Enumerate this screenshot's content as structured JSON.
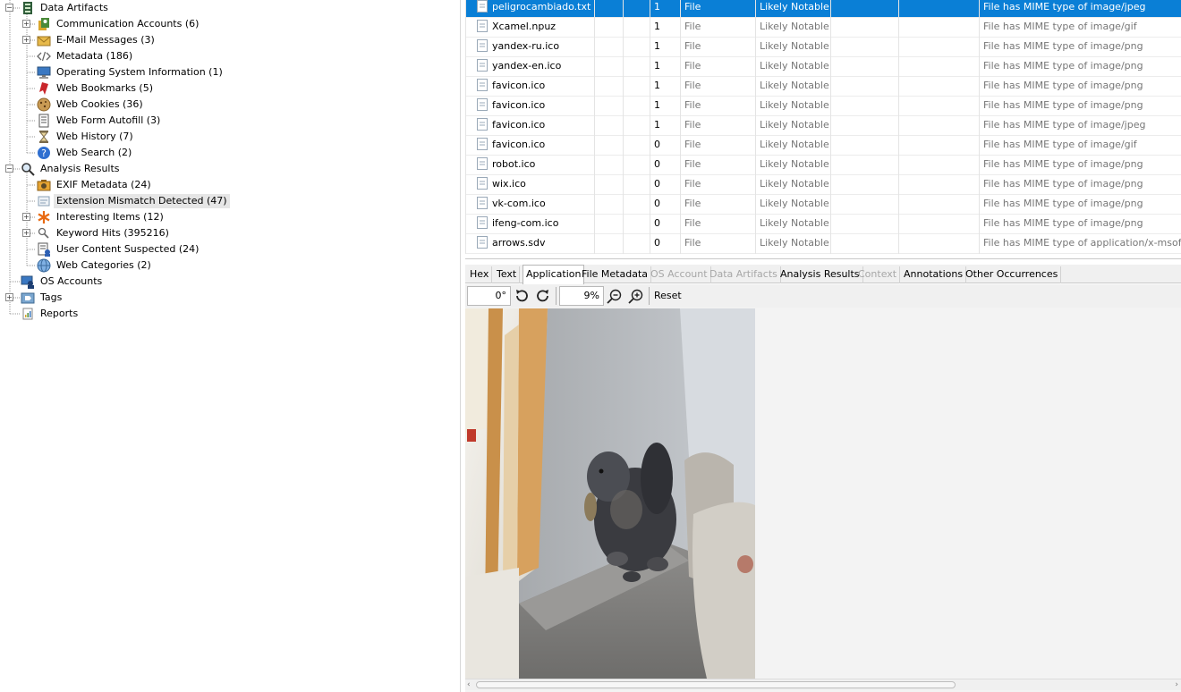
{
  "tree": {
    "data_artifacts": "Data Artifacts",
    "communication_accounts": "Communication Accounts (6)",
    "email_messages": "E-Mail Messages (3)",
    "metadata": "Metadata (186)",
    "os_info": "Operating System Information (1)",
    "web_bookmarks": "Web Bookmarks (5)",
    "web_cookies": "Web Cookies (36)",
    "web_form_autofill": "Web Form Autofill (3)",
    "web_history": "Web History (7)",
    "web_search": "Web Search (2)",
    "analysis_results": "Analysis Results",
    "exif_metadata": "EXIF Metadata (24)",
    "extension_mismatch": "Extension Mismatch Detected (47)",
    "interesting_items": "Interesting Items (12)",
    "keyword_hits": "Keyword Hits (395216)",
    "user_content_suspected": "User Content Suspected (24)",
    "web_categories": "Web Categories (2)",
    "os_accounts": "OS Accounts",
    "tags": "Tags",
    "reports": "Reports"
  },
  "table": {
    "rows": [
      {
        "name": "peligrocambiado.txt",
        "count": "1",
        "type": "File",
        "score": "Likely Notable",
        "comment": "File has MIME type of image/jpeg"
      },
      {
        "name": "Xcamel.npuz",
        "count": "1",
        "type": "File",
        "score": "Likely Notable",
        "comment": "File has MIME type of image/gif"
      },
      {
        "name": "yandex-ru.ico",
        "count": "1",
        "type": "File",
        "score": "Likely Notable",
        "comment": "File has MIME type of image/png"
      },
      {
        "name": "yandex-en.ico",
        "count": "1",
        "type": "File",
        "score": "Likely Notable",
        "comment": "File has MIME type of image/png"
      },
      {
        "name": "favicon.ico",
        "count": "1",
        "type": "File",
        "score": "Likely Notable",
        "comment": "File has MIME type of image/png"
      },
      {
        "name": "favicon.ico",
        "count": "1",
        "type": "File",
        "score": "Likely Notable",
        "comment": "File has MIME type of image/png"
      },
      {
        "name": "favicon.ico",
        "count": "1",
        "type": "File",
        "score": "Likely Notable",
        "comment": "File has MIME type of image/jpeg"
      },
      {
        "name": "favicon.ico",
        "count": "0",
        "type": "File",
        "score": "Likely Notable",
        "comment": "File has MIME type of image/gif"
      },
      {
        "name": "robot.ico",
        "count": "0",
        "type": "File",
        "score": "Likely Notable",
        "comment": "File has MIME type of image/png"
      },
      {
        "name": "wix.ico",
        "count": "0",
        "type": "File",
        "score": "Likely Notable",
        "comment": "File has MIME type of image/png"
      },
      {
        "name": "vk-com.ico",
        "count": "0",
        "type": "File",
        "score": "Likely Notable",
        "comment": "File has MIME type of image/png"
      },
      {
        "name": "ifeng-com.ico",
        "count": "0",
        "type": "File",
        "score": "Likely Notable",
        "comment": "File has MIME type of image/png"
      },
      {
        "name": "arrows.sdv",
        "count": "0",
        "type": "File",
        "score": "Likely Notable",
        "comment": "File has MIME type of application/x-msoffice"
      }
    ]
  },
  "tabs": {
    "hex": "Hex",
    "text": "Text",
    "application": "Application",
    "file_metadata": "File Metadata",
    "os_account": "OS Account",
    "data_artifacts": "Data Artifacts",
    "analysis_results": "Analysis Results",
    "context": "Context",
    "annotations": "Annotations",
    "other_occurrences": "Other Occurrences"
  },
  "viewer": {
    "rotation": "0°",
    "zoom": "9%",
    "reset_label": "Reset"
  },
  "colors": {
    "selection": "#0a7fd6",
    "disabled_tab_text": "#a7a7a7"
  }
}
